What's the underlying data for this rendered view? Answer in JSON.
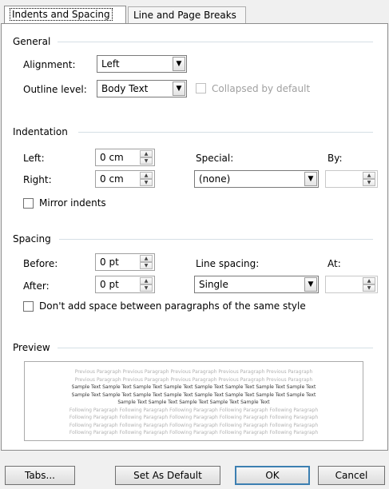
{
  "tabs": {
    "indents_spacing": "Indents and Spacing",
    "line_page_breaks": "Line and Page Breaks"
  },
  "general": {
    "title": "General",
    "alignment_label": "Alignment:",
    "alignment_value": "Left",
    "outline_label": "Outline level:",
    "outline_value": "Body Text",
    "collapsed_label": "Collapsed by default"
  },
  "indentation": {
    "title": "Indentation",
    "left_label": "Left:",
    "left_value": "0 cm",
    "right_label": "Right:",
    "right_value": "0 cm",
    "special_label": "Special:",
    "special_value": "(none)",
    "by_label": "By:",
    "by_value": "",
    "mirror_label": "Mirror indents"
  },
  "spacing": {
    "title": "Spacing",
    "before_label": "Before:",
    "before_value": "0 pt",
    "after_label": "After:",
    "after_value": "0 pt",
    "line_spacing_label": "Line spacing:",
    "line_spacing_value": "Single",
    "at_label": "At:",
    "at_value": "",
    "dont_add_label": "Don't add space between paragraphs of the same style"
  },
  "preview": {
    "title": "Preview",
    "lines": [
      {
        "kind": "prev",
        "text": "Previous Paragraph Previous Paragraph Previous Paragraph Previous Paragraph Previous Paragraph"
      },
      {
        "kind": "prev",
        "text": "Previous Paragraph Previous Paragraph Previous Paragraph Previous Paragraph Previous Paragraph"
      },
      {
        "kind": "sample",
        "text": "Sample Text Sample Text Sample Text Sample Text Sample Text Sample Text Sample Text Sample Text"
      },
      {
        "kind": "sample",
        "text": "Sample Text Sample Text Sample Text Sample Text Sample Text Sample Text Sample Text Sample Text"
      },
      {
        "kind": "sample",
        "text": "Sample Text Sample Text Sample Text Sample Text Sample Text"
      },
      {
        "kind": "prev",
        "text": "Following Paragraph Following Paragraph Following Paragraph Following Paragraph Following Paragraph"
      },
      {
        "kind": "prev",
        "text": "Following Paragraph Following Paragraph Following Paragraph Following Paragraph Following Paragraph"
      },
      {
        "kind": "prev",
        "text": "Following Paragraph Following Paragraph Following Paragraph Following Paragraph Following Paragraph"
      },
      {
        "kind": "prev",
        "text": "Following Paragraph Following Paragraph Following Paragraph Following Paragraph Following Paragraph"
      }
    ]
  },
  "buttons": {
    "tabs": "Tabs...",
    "set_default": "Set As Default",
    "ok": "OK",
    "cancel": "Cancel"
  }
}
